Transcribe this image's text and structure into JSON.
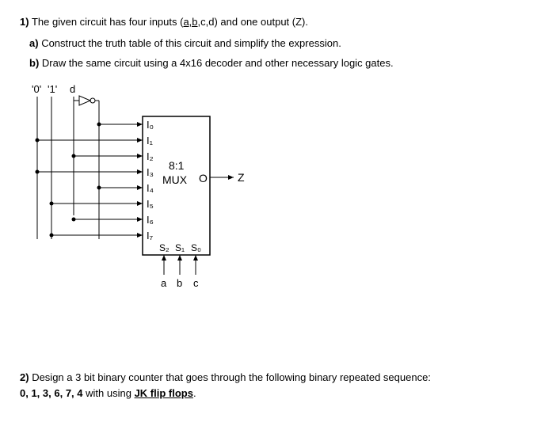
{
  "q1": {
    "number": "1)",
    "intro_before": "The given circuit has four inputs (",
    "inputs_underlined": "a,b",
    "intro_after": ",c,d) and one output (Z).",
    "part_a_label": "a)",
    "part_a_text": "Construct the truth table of this circuit and simplify the expression.",
    "part_b_label": "b)",
    "part_b_text": "Draw the same circuit using a 4x16 decoder and other necessary logic gates."
  },
  "circuit": {
    "labels": {
      "zero": "'0'",
      "one": "'1'",
      "d": "d",
      "i0": "I₀",
      "i1": "I₁",
      "i2": "I₂",
      "i3": "I₃",
      "i4": "I₄",
      "i5": "I₅",
      "i6": "I₆",
      "i7": "I₇",
      "mux_ratio": "8:1",
      "mux_name": "MUX",
      "output_o": "O",
      "output_z": "Z",
      "s2": "S₂",
      "s1": "S₁",
      "s0": "S₀",
      "sel_a": "a",
      "sel_b": "b",
      "sel_c": "c"
    }
  },
  "q2": {
    "number": "2)",
    "text_before": "Design a 3 bit binary counter that goes through the following binary repeated sequence:",
    "sequence": "0, 1, 3, 6, 7, 4",
    "with_using": "with using",
    "flip_flops": "JK flip flops",
    "period": "."
  }
}
